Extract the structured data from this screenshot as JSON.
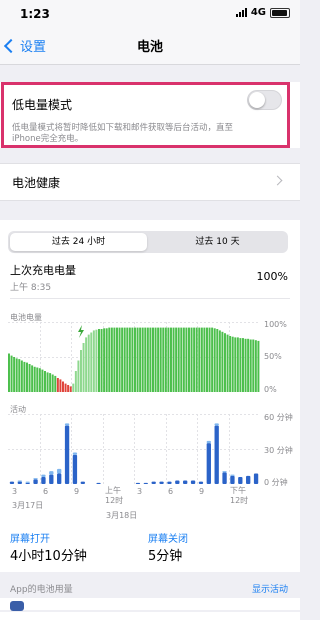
{
  "status_bar": {
    "time": "1:23",
    "network": "4G"
  },
  "nav": {
    "back_label": "设置",
    "title": "电池"
  },
  "low_power": {
    "label": "低电量模式",
    "enabled": false,
    "description_line1": "低电量模式将暂时降低如下载和邮件获取等后台活动，直至",
    "description_line2": "iPhone完全充电。"
  },
  "battery_health": {
    "label": "电池健康"
  },
  "tabs": [
    {
      "label": "过去 24 小时",
      "active": true
    },
    {
      "label": "过去 10 天",
      "active": false
    }
  ],
  "last_charge": {
    "label": "上次充电电量",
    "time": "上午 8:35",
    "value": "100%"
  },
  "level_chart": {
    "title": "电池电量",
    "y_ticks": [
      "100%",
      "50%",
      "0%"
    ]
  },
  "activity_chart": {
    "title": "活动",
    "y_ticks": [
      "60 分钟",
      "30 分钟",
      "0 分钟"
    ]
  },
  "x_axis": {
    "labels": [
      "3",
      "6",
      "9",
      "上午\n12时",
      "3",
      "6",
      "9",
      "下午\n12时"
    ],
    "date_left": "3月17日",
    "date_right": "3月18日"
  },
  "screen_on": {
    "label": "屏幕打开",
    "value": "4小时10分钟"
  },
  "screen_off": {
    "label": "屏幕关闭",
    "value": "5分钟"
  },
  "app_usage": {
    "label": "App的电池用量",
    "action": "显示活动"
  },
  "chart_data": [
    {
      "type": "bar",
      "title": "电池电量",
      "y_unit": "%",
      "ylim": [
        0,
        100
      ],
      "values": [
        55,
        52,
        50,
        48,
        47,
        45,
        43,
        42,
        40,
        38,
        36,
        35,
        34,
        32,
        30,
        28,
        27,
        25,
        23,
        20,
        18,
        15,
        12,
        10,
        8,
        12,
        30,
        45,
        60,
        70,
        78,
        82,
        85,
        88,
        89,
        90,
        90,
        91,
        91,
        92,
        92,
        92,
        92,
        92,
        92,
        92,
        92,
        92,
        92,
        92,
        92,
        92,
        92,
        92,
        92,
        92,
        92,
        92,
        92,
        92,
        92,
        92,
        92,
        92,
        92,
        92,
        92,
        92,
        92,
        92,
        92,
        92,
        92,
        92,
        92,
        92,
        92,
        92,
        92,
        92,
        91,
        90,
        88,
        86,
        84,
        82,
        80,
        79,
        78,
        78,
        77,
        77,
        76,
        76,
        75,
        75,
        74,
        73
      ],
      "charging_segment_start_index": 25,
      "low_battery_threshold": 20
    },
    {
      "type": "bar",
      "title": "活动",
      "y_unit": "分钟",
      "ylim": [
        0,
        60
      ],
      "series": [
        {
          "name": "屏幕打开",
          "values": [
            2,
            2,
            1,
            4,
            6,
            8,
            9,
            50,
            25,
            2,
            0,
            1,
            0,
            0,
            0,
            0,
            1,
            1,
            2,
            2,
            2,
            3,
            3,
            3,
            2,
            35,
            50,
            10,
            7,
            6,
            7,
            9
          ]
        },
        {
          "name": "屏幕关闭",
          "values": [
            0,
            1,
            1,
            1,
            2,
            3,
            4,
            2,
            2,
            0,
            0,
            0,
            0,
            0,
            0,
            0,
            0,
            0,
            0,
            0,
            0,
            0,
            0,
            0,
            0,
            2,
            2,
            1,
            1,
            0,
            0,
            0
          ]
        }
      ]
    }
  ]
}
